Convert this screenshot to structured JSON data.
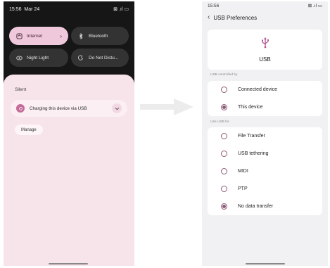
{
  "left": {
    "status": {
      "time": "15:56",
      "date": "Mar 24",
      "icons_text": "⊠ .ıl ▭"
    },
    "tiles": [
      {
        "label": "Internet",
        "icon": "wifi-icon",
        "active": true
      },
      {
        "label": "Bluetooth",
        "icon": "bluetooth-icon",
        "active": false
      },
      {
        "label": "Night Light",
        "icon": "eye-icon",
        "active": false
      },
      {
        "label": "Do Not Distu...",
        "icon": "dnd-icon",
        "active": false
      }
    ],
    "shade_label": "Silent",
    "notification": {
      "text": "Charging this device via USB",
      "icon": "usb-notification-icon"
    },
    "manage_label": "Manage"
  },
  "right": {
    "status": {
      "time": "15:56",
      "icons_text": "⊠ .ıl ▭"
    },
    "title": "USB Preferences",
    "usb_label": "USB",
    "controlled_by": {
      "label": "USB controlled by",
      "options": [
        {
          "label": "Connected device",
          "selected": false
        },
        {
          "label": "This device",
          "selected": true
        }
      ]
    },
    "use_for": {
      "label": "Use USB for",
      "options": [
        {
          "label": "File Transfer",
          "selected": false
        },
        {
          "label": "USB tethering",
          "selected": false
        },
        {
          "label": "MIDI",
          "selected": false
        },
        {
          "label": "PTP",
          "selected": false
        },
        {
          "label": "No data transfer",
          "selected": true
        }
      ]
    }
  },
  "colors": {
    "accent": "#8c5a78",
    "tile_active": "#f0c8dc",
    "shade_bg": "#f7e4ea",
    "usb_icon": "#b0508e"
  }
}
